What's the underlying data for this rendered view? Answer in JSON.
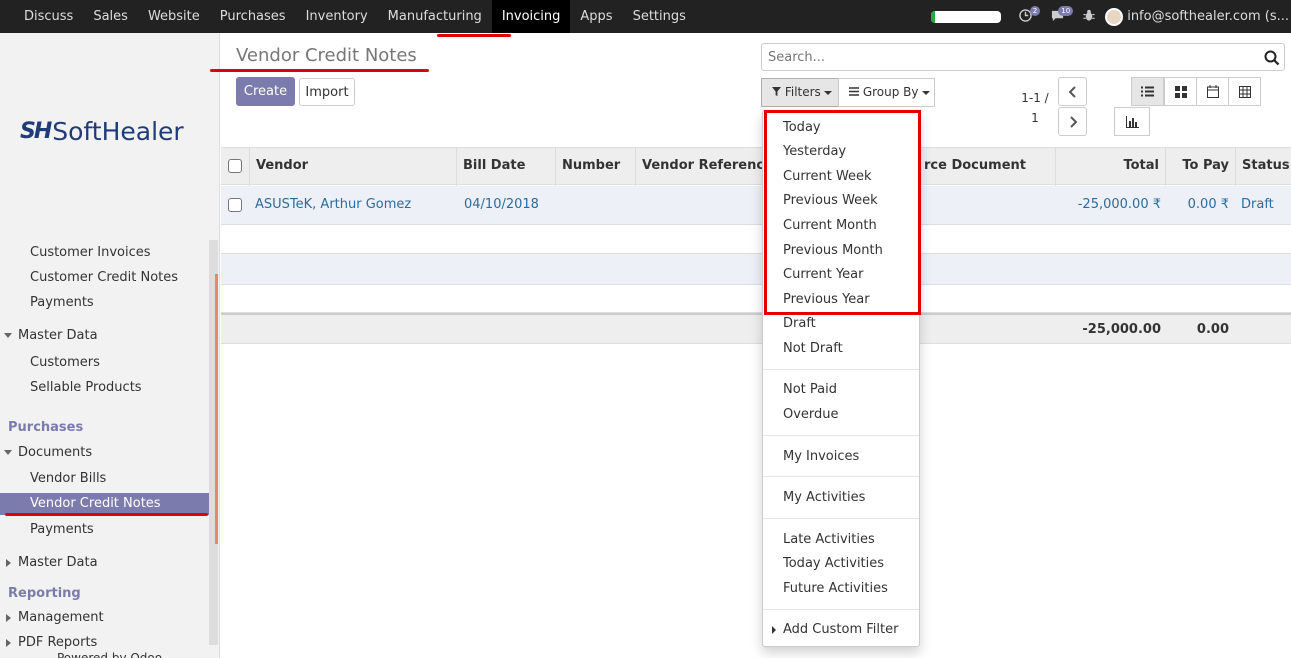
{
  "navbar": {
    "menu": [
      "Discuss",
      "Sales",
      "Website",
      "Purchases",
      "Inventory",
      "Manufacturing",
      "Invoicing",
      "Apps",
      "Settings"
    ],
    "active": "Invoicing",
    "progress_fraction": 0.05,
    "activity_badge": "2",
    "messages_badge": "10",
    "user": "info@softhealer.com (s..."
  },
  "sidebar": {
    "logo_mark": "SH",
    "logo_text": "SoftHealer",
    "items": [
      {
        "label": "Customer Invoices"
      },
      {
        "label": "Customer Credit Notes"
      },
      {
        "label": "Payments"
      },
      {
        "label": "Master Data"
      },
      {
        "label": "Customers"
      },
      {
        "label": "Sellable Products"
      },
      {
        "label": "Purchases"
      },
      {
        "label": "Documents"
      },
      {
        "label": "Vendor Bills"
      },
      {
        "label": "Vendor Credit Notes"
      },
      {
        "label": "Payments"
      },
      {
        "label": "Master Data"
      },
      {
        "label": "Reporting"
      },
      {
        "label": "Management"
      },
      {
        "label": "PDF Reports"
      },
      {
        "label": "Powered by Odoo"
      }
    ]
  },
  "control": {
    "breadcrumb": "Vendor Credit Notes",
    "create": "Create",
    "import": "Import",
    "search_placeholder": "Search...",
    "filters": "Filters",
    "groupby": "Group By",
    "pager_range": "1-1 /",
    "pager_total": "1"
  },
  "table": {
    "columns": [
      "Vendor",
      "Bill Date",
      "Number",
      "Vendor Reference",
      "rce Document",
      "Total",
      "To Pay",
      "Status"
    ],
    "rows": [
      {
        "vendor": "ASUSTeK, Arthur Gomez",
        "bill_date": "04/10/2018",
        "total": "-25,000.00 ₹",
        "to_pay": "0.00 ₹",
        "status": "Draft"
      }
    ],
    "footer": {
      "total": "-25,000.00",
      "to_pay": "0.00"
    }
  },
  "filters_menu": {
    "group1": [
      "Today",
      "Yesterday",
      "Current Week",
      "Previous Week",
      "Current Month",
      "Previous Month",
      "Current Year",
      "Previous Year",
      "Draft",
      "Not Draft"
    ],
    "group2": [
      "Not Paid",
      "Overdue"
    ],
    "group3": [
      "My Invoices"
    ],
    "group4": [
      "My Activities"
    ],
    "group5": [
      "Late Activities",
      "Today Activities",
      "Future Activities"
    ],
    "custom": "Add Custom Filter"
  },
  "colors": {
    "accent": "#7c7bad",
    "annotation": "#e00000",
    "navbar": "#222222"
  }
}
